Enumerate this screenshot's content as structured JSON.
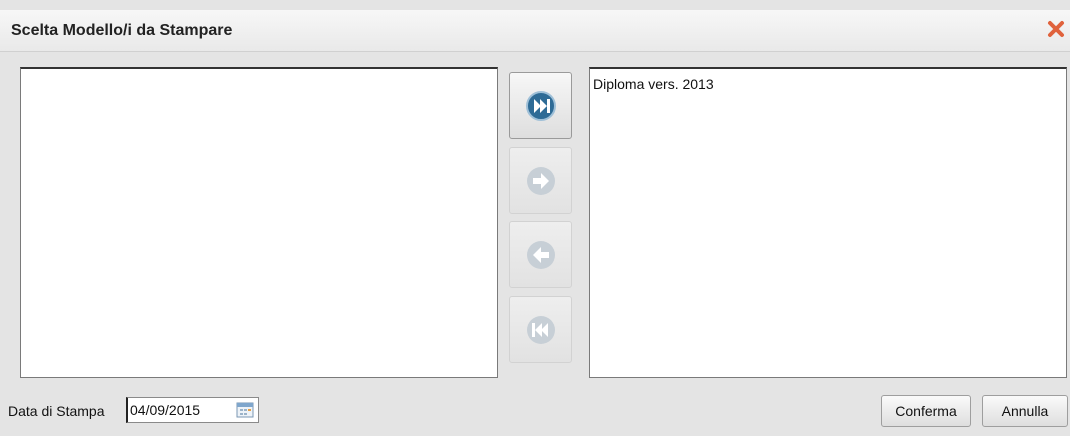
{
  "dialog": {
    "title": "Scelta Modello/i da Stampare",
    "close_icon": "close-x-icon"
  },
  "available_list": {
    "items": []
  },
  "selected_list": {
    "items": [
      "Diploma vers. 2013"
    ]
  },
  "move_buttons": [
    {
      "name": "move-all-right-button",
      "icon": "double-chevron-right-icon",
      "enabled": true
    },
    {
      "name": "move-right-button",
      "icon": "arrow-right-icon",
      "enabled": false
    },
    {
      "name": "move-left-button",
      "icon": "arrow-left-icon",
      "enabled": false
    },
    {
      "name": "move-all-left-button",
      "icon": "double-chevron-left-icon",
      "enabled": false
    }
  ],
  "footer": {
    "date_label": "Data di Stampa",
    "date_value": "04/09/2015",
    "calendar_icon": "calendar-icon",
    "confirm_label": "Conferma",
    "cancel_label": "Annulla"
  },
  "colors": {
    "close": "#e0623c",
    "icon_active": "#2e6b96",
    "icon_disabled": "#c7cfd6"
  }
}
